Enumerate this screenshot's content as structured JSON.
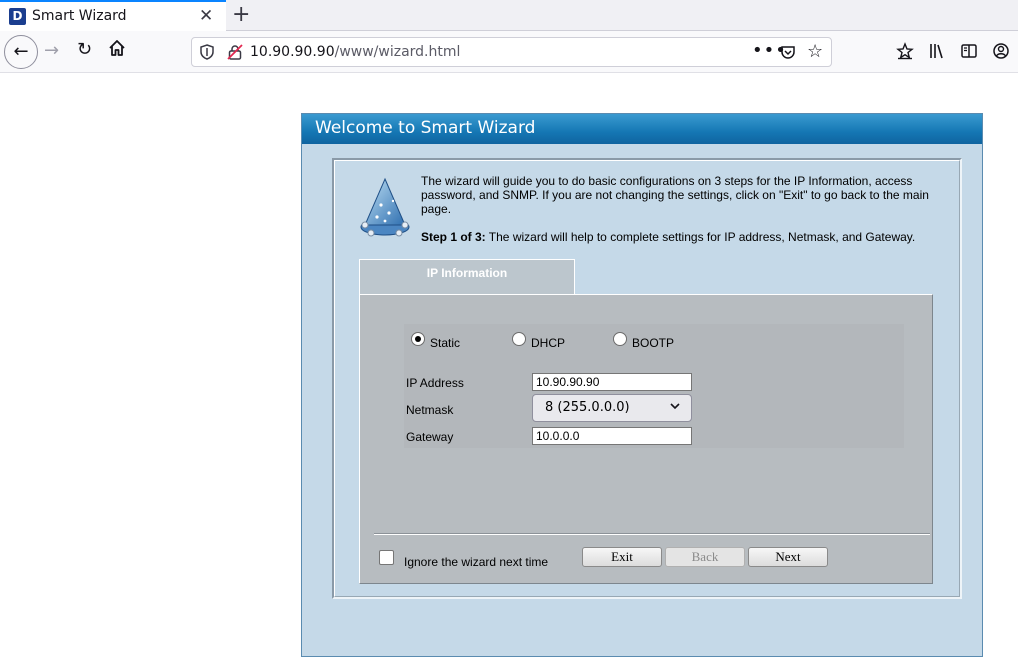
{
  "browser": {
    "tab_title": "Smart Wizard",
    "favicon_letter": "D",
    "url_host": "10.90.90.90",
    "url_path": "/www/wizard.html"
  },
  "wizard": {
    "header": "Welcome to Smart Wizard",
    "intro": "The wizard will guide you to do basic configurations on 3 steps for the IP Information, access password, and SNMP. If you are not changing the settings, click on \"Exit\" to go back to the main page.",
    "step_prefix": "Step 1 of 3:",
    "step_text": " The wizard will help to complete settings for IP address, Netmask, and Gateway.",
    "tab_label": "IP Information",
    "modes": [
      {
        "label": "Static",
        "selected": true
      },
      {
        "label": "DHCP",
        "selected": false
      },
      {
        "label": "BOOTP",
        "selected": false
      }
    ],
    "fields": {
      "ip_label": "IP Address",
      "ip_value": "10.90.90.90",
      "netmask_label": "Netmask",
      "netmask_value": "8 (255.0.0.0)",
      "gateway_label": "Gateway",
      "gateway_value": "10.0.0.0"
    },
    "ignore_label": "Ignore the wizard next time",
    "buttons": {
      "exit": "Exit",
      "back": "Back",
      "next": "Next"
    }
  },
  "colors": {
    "header_blue": "#1577b4",
    "frame_bg": "#c5d9e8",
    "content_gray": "#b7bcc0"
  }
}
